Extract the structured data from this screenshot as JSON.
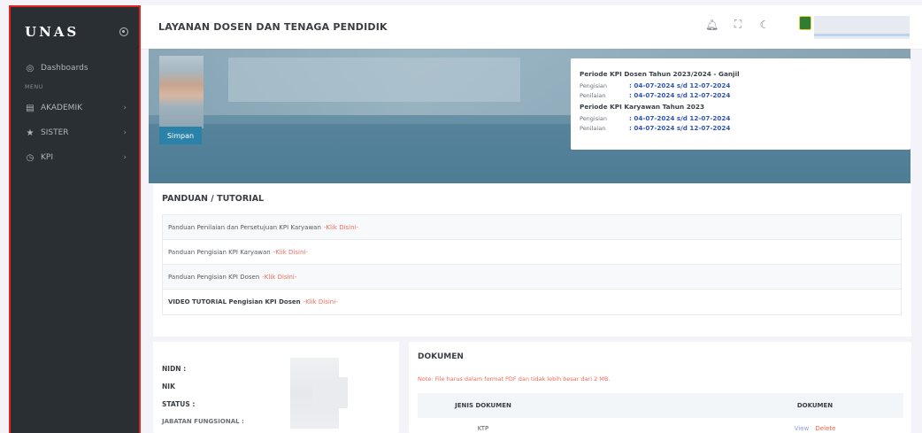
{
  "sidebar": {
    "brand": "UNAS",
    "items": [
      {
        "label": "Dashboards"
      },
      {
        "label": "AKADEMIK"
      },
      {
        "label": "SISTER"
      },
      {
        "label": "KPI"
      }
    ],
    "menu_label": "MENU"
  },
  "topbar": {
    "title": "LAYANAN DOSEN DAN TENAGA PENDIDIK"
  },
  "hero": {
    "save_label": "Simpan"
  },
  "kpi": {
    "dosen_title": "Periode KPI Dosen Tahun 2023/2024 - Ganjil",
    "dosen_rows": [
      {
        "label": "Pengisian",
        "value": ": 04-07-2024 s/d 12-07-2024"
      },
      {
        "label": "Penilaian",
        "value": ": 04-07-2024 s/d 12-07-2024"
      }
    ],
    "karyawan_title": "Periode KPI Karyawan Tahun 2023",
    "karyawan_rows": [
      {
        "label": "Pengisian",
        "value": ": 04-07-2024 s/d 12-07-2024"
      },
      {
        "label": "Penilaian",
        "value": ": 04-07-2024 s/d 12-07-2024"
      }
    ]
  },
  "panduan": {
    "title": "PANDUAN / TUTORIAL",
    "link_text": "-Klik Disini-",
    "items": [
      {
        "text": "Panduan Penilaian dan Persetujuan KPI Karyawan"
      },
      {
        "text": "Panduan Pengisian KPI Karyawan"
      },
      {
        "text": "Panduan Pengisian KPI Dosen"
      },
      {
        "text": "VIDEO TUTORIAL Pengisian KPI Dosen"
      }
    ]
  },
  "profile": {
    "nidn": "NIDN :",
    "nik": "NIK",
    "status": "STATUS :",
    "partial": "JABATAN FUNGSIONAL :"
  },
  "dokumen": {
    "title": "DOKUMEN",
    "note": "Note: File harus dalam format PDF dan tidak lebih besar dari 2 MB.",
    "col_jenis": "JENIS DOKUMEN",
    "col_dokumen": "DOKUMEN",
    "rows": [
      {
        "jenis": "KTP",
        "view": "View",
        "delete": "Delete"
      }
    ]
  }
}
